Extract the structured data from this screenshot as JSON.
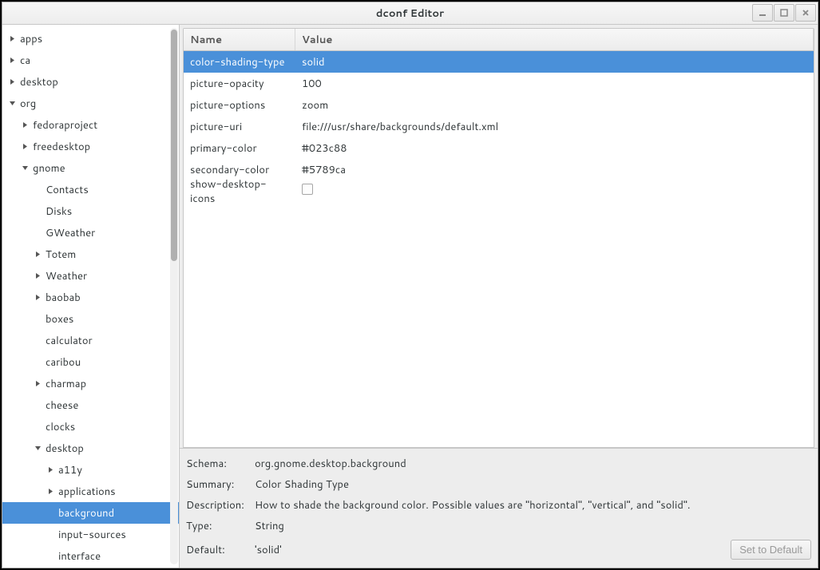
{
  "window": {
    "title": "dconf Editor"
  },
  "tree": [
    {
      "label": "apps",
      "indent": 0,
      "exp": "right"
    },
    {
      "label": "ca",
      "indent": 0,
      "exp": "right"
    },
    {
      "label": "desktop",
      "indent": 0,
      "exp": "right"
    },
    {
      "label": "org",
      "indent": 0,
      "exp": "down"
    },
    {
      "label": "fedoraproject",
      "indent": 1,
      "exp": "right"
    },
    {
      "label": "freedesktop",
      "indent": 1,
      "exp": "right"
    },
    {
      "label": "gnome",
      "indent": 1,
      "exp": "down"
    },
    {
      "label": "Contacts",
      "indent": 2,
      "exp": "none"
    },
    {
      "label": "Disks",
      "indent": 2,
      "exp": "none"
    },
    {
      "label": "GWeather",
      "indent": 2,
      "exp": "none"
    },
    {
      "label": "Totem",
      "indent": 2,
      "exp": "right"
    },
    {
      "label": "Weather",
      "indent": 2,
      "exp": "right"
    },
    {
      "label": "baobab",
      "indent": 2,
      "exp": "right"
    },
    {
      "label": "boxes",
      "indent": 2,
      "exp": "none"
    },
    {
      "label": "calculator",
      "indent": 2,
      "exp": "none"
    },
    {
      "label": "caribou",
      "indent": 2,
      "exp": "none"
    },
    {
      "label": "charmap",
      "indent": 2,
      "exp": "right"
    },
    {
      "label": "cheese",
      "indent": 2,
      "exp": "none"
    },
    {
      "label": "clocks",
      "indent": 2,
      "exp": "none"
    },
    {
      "label": "desktop",
      "indent": 2,
      "exp": "down"
    },
    {
      "label": "a11y",
      "indent": 3,
      "exp": "right"
    },
    {
      "label": "applications",
      "indent": 3,
      "exp": "right"
    },
    {
      "label": "background",
      "indent": 3,
      "exp": "none",
      "selected": true
    },
    {
      "label": "input-sources",
      "indent": 3,
      "exp": "none"
    },
    {
      "label": "interface",
      "indent": 3,
      "exp": "none"
    }
  ],
  "table": {
    "headers": {
      "name": "Name",
      "value": "Value"
    },
    "rows": [
      {
        "name": "color-shading-type",
        "value": "solid",
        "selected": true
      },
      {
        "name": "picture-opacity",
        "value": "100"
      },
      {
        "name": "picture-options",
        "value": "zoom"
      },
      {
        "name": "picture-uri",
        "value": "file:///usr/share/backgrounds/default.xml"
      },
      {
        "name": "primary-color",
        "value": "#023c88"
      },
      {
        "name": "secondary-color",
        "value": "#5789ca"
      },
      {
        "name": "show-desktop-icons",
        "value": "",
        "checkbox": true
      }
    ]
  },
  "detail": {
    "labels": {
      "schema": "Schema:",
      "summary": "Summary:",
      "description": "Description:",
      "type": "Type:",
      "default_l": "Default:"
    },
    "schema": "org.gnome.desktop.background",
    "summary": "Color Shading Type",
    "description": "How to shade the background color. Possible values are \"horizontal\", \"vertical\", and \"solid\".",
    "type": "String",
    "default_v": "'solid'",
    "set_default_button": "Set to Default"
  }
}
